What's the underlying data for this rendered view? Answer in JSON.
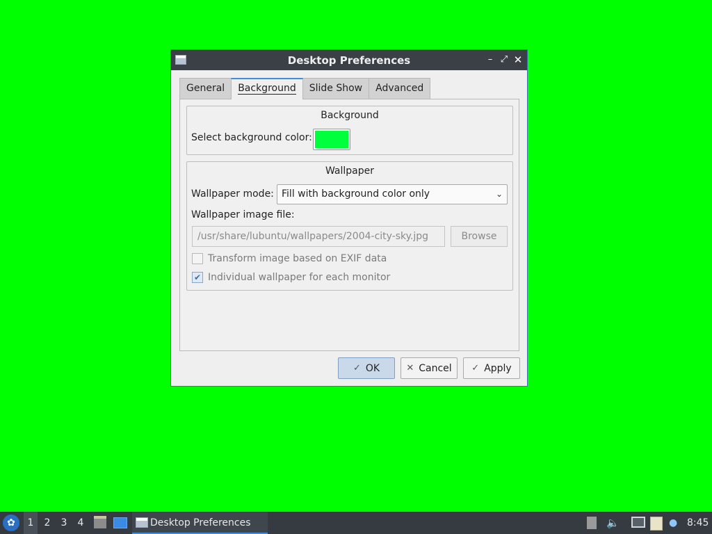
{
  "window": {
    "title": "Desktop Preferences",
    "controls": {
      "minimize": "–",
      "maximize": "⤢",
      "close": "✕"
    }
  },
  "tabs": [
    {
      "label": "General"
    },
    {
      "label": "Background"
    },
    {
      "label": "Slide Show"
    },
    {
      "label": "Advanced"
    }
  ],
  "active_tab": "Background",
  "background_group": {
    "title": "Background",
    "color_label": "Select background color:",
    "color_value": "#00ff3c"
  },
  "wallpaper_group": {
    "title": "Wallpaper",
    "mode_label": "Wallpaper mode:",
    "mode_value": "Fill with background color only",
    "file_label": "Wallpaper image file:",
    "file_value": "/usr/share/lubuntu/wallpapers/2004-city-sky.jpg",
    "browse_label": "Browse",
    "exif_label": "Transform image based on EXIF data",
    "exif_checked": false,
    "per_monitor_label": "Individual wallpaper for each monitor",
    "per_monitor_checked": true
  },
  "buttons": {
    "ok": "OK",
    "cancel": "Cancel",
    "apply": "Apply"
  },
  "taskbar": {
    "workspaces": [
      "1",
      "2",
      "3",
      "4"
    ],
    "active_workspace": "1",
    "task_label": "Desktop Preferences",
    "clock": "8:45"
  },
  "colors": {
    "desktop": "#00ff00",
    "accent": "#3d8ee0",
    "taskbar": "#363b41",
    "titlebar": "#3b4046"
  }
}
